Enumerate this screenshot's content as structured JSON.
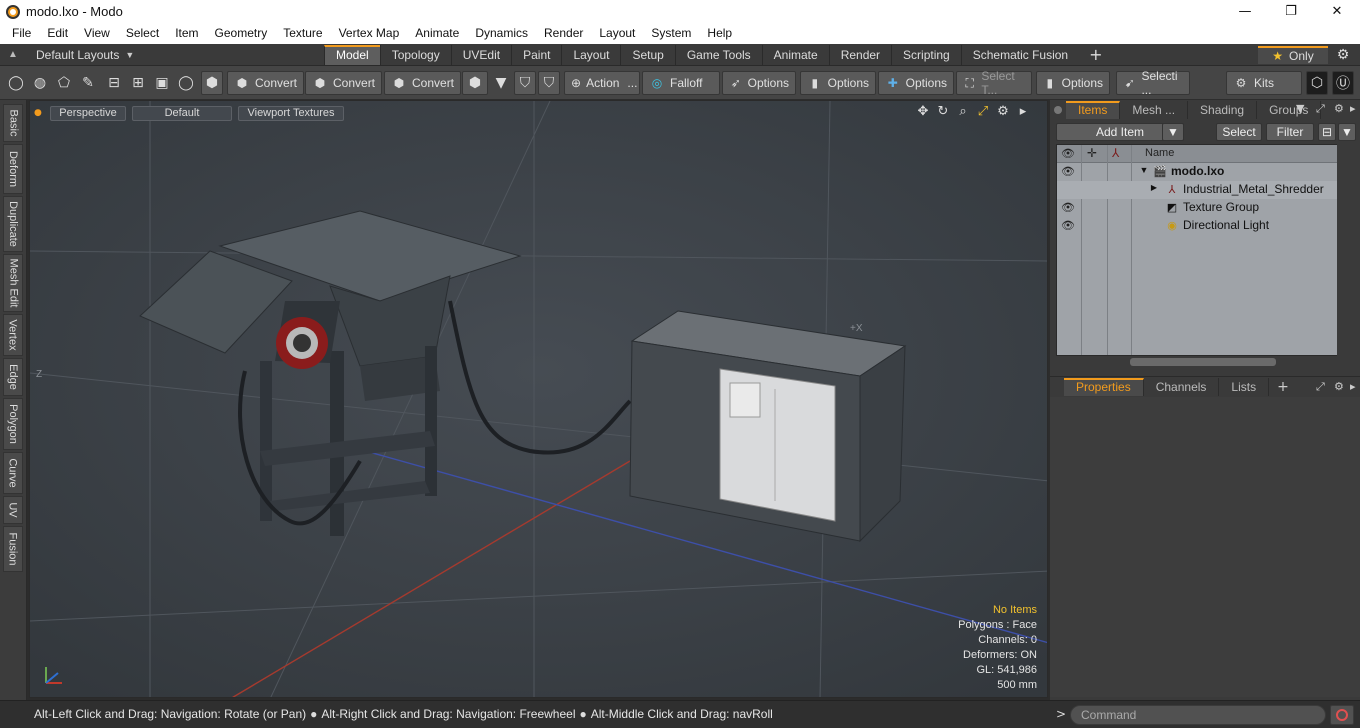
{
  "window": {
    "title": "modo.lxo - Modo",
    "minimize": "—",
    "maximize": "❐",
    "close": "✕"
  },
  "menu": [
    "File",
    "Edit",
    "View",
    "Select",
    "Item",
    "Geometry",
    "Texture",
    "Vertex Map",
    "Animate",
    "Dynamics",
    "Render",
    "Layout",
    "System",
    "Help"
  ],
  "layoutbar": {
    "layouts_label": "Default Layouts",
    "tabs": [
      "Model",
      "Topology",
      "UVEdit",
      "Paint",
      "Layout",
      "Setup",
      "Game Tools",
      "Animate",
      "Render",
      "Scripting",
      "Schematic Fusion"
    ],
    "active_tab": "Model",
    "only_label": "Only"
  },
  "toolbar": {
    "convert_1": "Convert",
    "convert_2": "Convert",
    "convert_3": "Convert",
    "action": "Action",
    "action_more": "...",
    "falloff": "Falloff",
    "options_1": "Options",
    "options_2": "Options",
    "options_3": "Options",
    "select_t": "Select T...",
    "options_4": "Options",
    "selecti": "Selecti ...",
    "kits": "Kits"
  },
  "left_tabs": [
    "Basic",
    "Deform",
    "Duplicate",
    "Mesh Edit",
    "Vertex",
    "Edge",
    "Polygon",
    "Curve",
    "UV",
    "Fusion"
  ],
  "viewport": {
    "view_mode": "Perspective",
    "shading": "Default",
    "textures": "Viewport Textures",
    "info": {
      "items": "No Items",
      "polygons": "Polygons : Face",
      "channels": "Channels: 0",
      "deformers": "Deformers: ON",
      "gl": "GL: 541,986",
      "scale": "500 mm"
    },
    "axis_z_label": "Z",
    "axis_x_label": "+X"
  },
  "items_panel": {
    "tabs": [
      "Items",
      "Mesh ...",
      "Shading",
      "Groups"
    ],
    "active_tab": "Items",
    "add_item": "Add Item",
    "select": "Select",
    "filter": "Filter",
    "column_name": "Name",
    "rows": [
      {
        "label": "modo.lxo",
        "icon": "scene-icon",
        "eye": true,
        "bold": true
      },
      {
        "label": "Industrial_Metal_Shredder",
        "icon": "mesh-locator-icon",
        "eye": false,
        "bold": false
      },
      {
        "label": "Texture Group",
        "icon": "texture-group-icon",
        "eye": true,
        "bold": false
      },
      {
        "label": "Directional Light",
        "icon": "light-icon",
        "eye": true,
        "bold": false
      }
    ]
  },
  "properties_panel": {
    "tabs": [
      "Properties",
      "Channels",
      "Lists"
    ],
    "active_tab": "Properties"
  },
  "statusbar": {
    "hint_1": "Alt-Left Click and Drag: Navigation: Rotate (or Pan)",
    "hint_2": "Alt-Right Click and Drag: Navigation: Freewheel",
    "hint_3": "Alt-Middle Click and Drag: navRoll",
    "command_placeholder": "Command"
  },
  "colors": {
    "accent": "#f29b1d",
    "viewport_bg": "#3b4046",
    "panel_bg": "#3a3a3a",
    "warn_text": "#f2c12e"
  }
}
